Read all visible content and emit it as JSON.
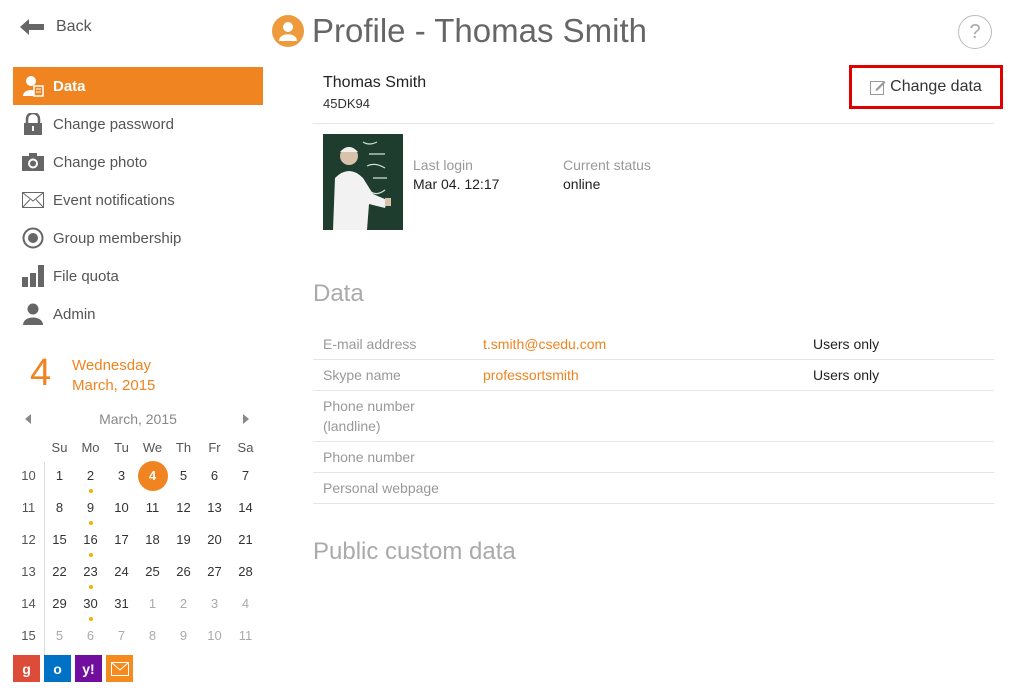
{
  "back_label": "Back",
  "page_title": "Profile - Thomas Smith",
  "nav": [
    {
      "label": "Data",
      "icon": "user-data-icon"
    },
    {
      "label": "Change password",
      "icon": "lock-icon"
    },
    {
      "label": "Change photo",
      "icon": "camera-icon"
    },
    {
      "label": "Event notifications",
      "icon": "envelope-icon"
    },
    {
      "label": "Group membership",
      "icon": "target-icon"
    },
    {
      "label": "File quota",
      "icon": "bar-chart-icon"
    },
    {
      "label": "Admin",
      "icon": "person-icon"
    }
  ],
  "date": {
    "day": "4",
    "weekday": "Wednesday",
    "month_year": "March, 2015"
  },
  "calendar": {
    "month": "March, 2015",
    "dow": [
      "Su",
      "Mo",
      "Tu",
      "We",
      "Th",
      "Fr",
      "Sa"
    ],
    "weeks": [
      {
        "wk": "10",
        "days": [
          "1",
          "2",
          "3",
          "4",
          "5",
          "6",
          "7"
        ]
      },
      {
        "wk": "11",
        "days": [
          "8",
          "9",
          "10",
          "11",
          "12",
          "13",
          "14"
        ]
      },
      {
        "wk": "12",
        "days": [
          "15",
          "16",
          "17",
          "18",
          "19",
          "20",
          "21"
        ]
      },
      {
        "wk": "13",
        "days": [
          "22",
          "23",
          "24",
          "25",
          "26",
          "27",
          "28"
        ]
      },
      {
        "wk": "14",
        "days": [
          "29",
          "30",
          "31",
          "1",
          "2",
          "3",
          "4"
        ]
      },
      {
        "wk": "15",
        "days": [
          "5",
          "6",
          "7",
          "8",
          "9",
          "10",
          "11"
        ]
      }
    ]
  },
  "user": {
    "name": "Thomas Smith",
    "id": "45DK94"
  },
  "change_data_label": "Change data",
  "last_login": {
    "label": "Last login",
    "value": "Mar 04. 12:17"
  },
  "current_status": {
    "label": "Current status",
    "value": "online"
  },
  "data_section_title": "Data",
  "data_rows": [
    {
      "key": "E-mail address",
      "value": "t.smith@csedu.com",
      "privacy": "Users only"
    },
    {
      "key": "Skype name",
      "value": "professortsmith",
      "privacy": "Users only"
    },
    {
      "key": "Phone number (landline)",
      "value": "",
      "privacy": ""
    },
    {
      "key": "Phone number",
      "value": "",
      "privacy": ""
    },
    {
      "key": "Personal webpage",
      "value": "",
      "privacy": ""
    }
  ],
  "custom_section_title": "Public custom data",
  "help_label": "?",
  "colors": {
    "accent": "#ef8420",
    "highlight_border": "#e00000"
  }
}
